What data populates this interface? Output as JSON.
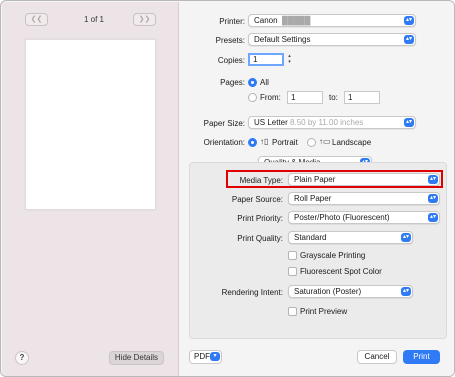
{
  "preview": {
    "prev_icon": "double-chevron-left-icon",
    "next_icon": "double-chevron-right-icon",
    "page_count": "1 of 1",
    "help_label": "?",
    "hide_details_label": "Hide Details"
  },
  "settings": {
    "printer_label": "Printer:",
    "printer_value": "Canon",
    "presets_label": "Presets:",
    "presets_value": "Default Settings",
    "copies_label": "Copies:",
    "copies_value": "1",
    "pages_label": "Pages:",
    "pages_all": "All",
    "pages_from": "From:",
    "from_value": "1",
    "pages_to": "to:",
    "to_value": "1",
    "paper_size_label": "Paper Size:",
    "paper_size_value": "US Letter",
    "paper_size_dims": "8.50 by 11.00 inches",
    "orientation_label": "Orientation:",
    "portrait_label": "Portrait",
    "landscape_label": "Landscape",
    "section_value": "Quality & Media"
  },
  "details": {
    "media_type_label": "Media Type:",
    "media_type_value": "Plain Paper",
    "paper_source_label": "Paper Source:",
    "paper_source_value": "Roll Paper",
    "print_priority_label": "Print Priority:",
    "print_priority_value": "Poster/Photo (Fluorescent)",
    "print_quality_label": "Print Quality:",
    "print_quality_value": "Standard",
    "grayscale_label": "Grayscale Printing",
    "fluorescent_label": "Fluorescent Spot Color",
    "rendering_intent_label": "Rendering Intent:",
    "rendering_intent_value": "Saturation (Poster)",
    "print_preview_label": "Print Preview"
  },
  "footer": {
    "pdf_label": "PDF",
    "cancel_label": "Cancel",
    "print_label": "Print"
  },
  "colors": {
    "accent": "#2f7bf6",
    "highlight": "#e00000"
  }
}
